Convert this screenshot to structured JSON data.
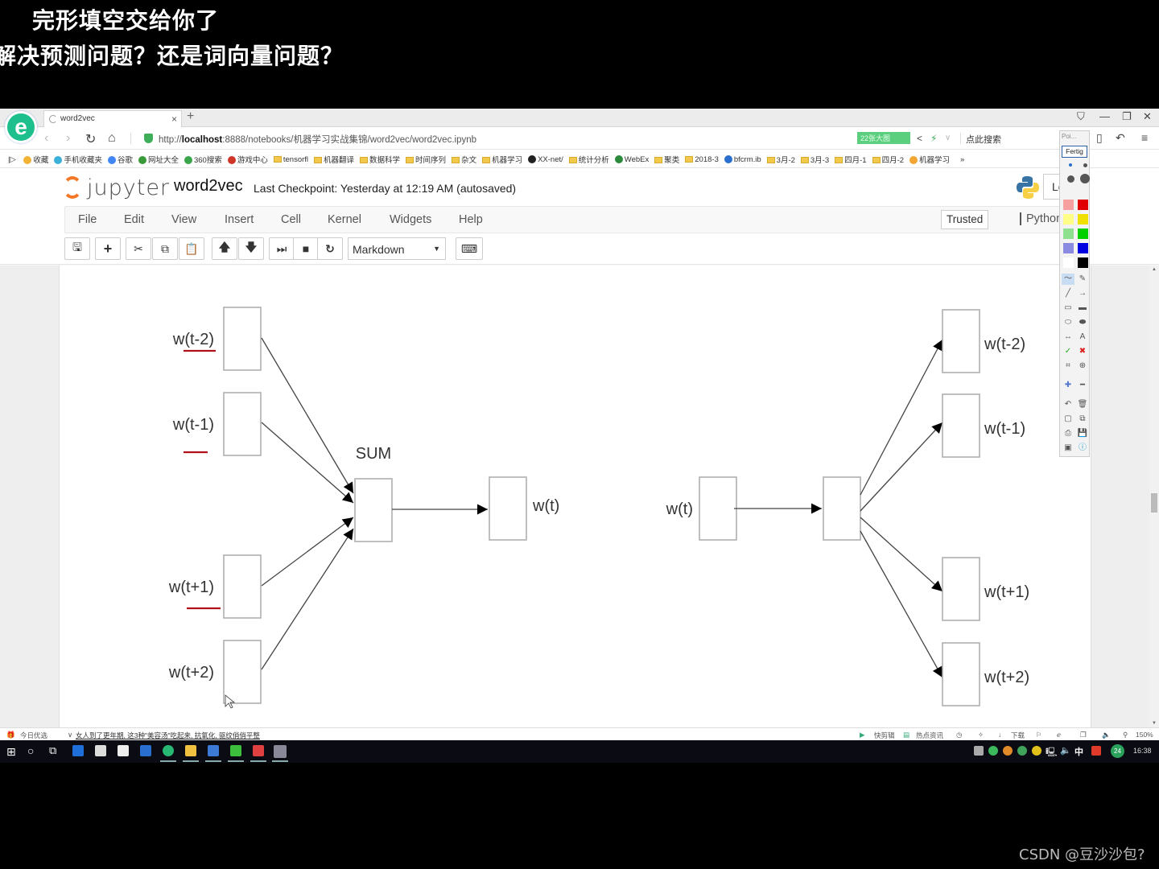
{
  "captions": {
    "line1": "完形填空交给你了",
    "line2": "解决预测问题？还是词向量问题？"
  },
  "browser": {
    "tab_title": "word2vec",
    "new_tab": "+",
    "url_prefix": "http://",
    "url_host": "localhost",
    "url_rest": ":8888/notebooks/机器学习实战集锦/word2vec/word2vec.ipynb",
    "promo_label": "22张大图",
    "search_placeholder": "点此搜索",
    "bookmarks": [
      {
        "label": "收藏",
        "type": "star"
      },
      {
        "label": "手机收藏夹",
        "type": "page"
      },
      {
        "label": "谷歌",
        "type": "g"
      },
      {
        "label": "网址大全",
        "type": "site"
      },
      {
        "label": "360搜索",
        "type": "360"
      },
      {
        "label": "游戏中心",
        "type": "game"
      },
      {
        "label": "tensorfl",
        "type": "folder"
      },
      {
        "label": "机器翻译",
        "type": "folder"
      },
      {
        "label": "数据科学",
        "type": "folder"
      },
      {
        "label": "时间序列",
        "type": "folder"
      },
      {
        "label": "杂文",
        "type": "folder"
      },
      {
        "label": "机器学习",
        "type": "folder"
      },
      {
        "label": "XX-net/",
        "type": "github"
      },
      {
        "label": "统计分析",
        "type": "folder"
      },
      {
        "label": "WebEx",
        "type": "webex"
      },
      {
        "label": "聚类",
        "type": "folder"
      },
      {
        "label": "2018-3",
        "type": "folder"
      },
      {
        "label": "bfcrm.ib",
        "type": "link"
      },
      {
        "label": "3月-2",
        "type": "folder"
      },
      {
        "label": "3月-3",
        "type": "folder"
      },
      {
        "label": "四月-1",
        "type": "folder"
      },
      {
        "label": "四月-2",
        "type": "folder"
      },
      {
        "label": "机器学习",
        "type": "special"
      }
    ],
    "bookmarks_more": "»"
  },
  "jupyter": {
    "logo_text": "jupyter",
    "notebook_name": "word2vec",
    "checkpoint": "Last Checkpoint: Yesterday at 12:19 AM (autosaved)",
    "logout_label": "Lo",
    "menu": [
      "File",
      "Edit",
      "View",
      "Insert",
      "Cell",
      "Kernel",
      "Widgets",
      "Help"
    ],
    "trusted_label": "Trusted",
    "kernel_label": "Python",
    "cell_type": "Markdown"
  },
  "drawing_tool": {
    "pointer_label": "Poi...",
    "done_label": "Fertig"
  },
  "diagram": {
    "cbow": {
      "inputs": [
        "w(t-2)",
        "w(t-1)",
        "w(t+1)",
        "w(t+2)"
      ],
      "hidden_label": "SUM",
      "output": "w(t)"
    },
    "skipgram": {
      "input": "w(t)",
      "outputs": [
        "w(t-2)",
        "w(t-1)",
        "w(t+1)",
        "w(t+2)"
      ]
    },
    "annotation_color": "#b0101a"
  },
  "statusbar": {
    "today_pick": "今日优选",
    "news": "女人到了更年期, 这3种\"美容汤\"吃起来, 抗氧化, 驱纹俏俏平整",
    "clip": "快剪辑",
    "hot_news": "热点资讯",
    "download": "下载",
    "zoom": "150%"
  },
  "taskbar": {
    "ime": "中",
    "notification_count": "24",
    "time": "16:38"
  },
  "watermark": "CSDN @豆沙沙包?"
}
